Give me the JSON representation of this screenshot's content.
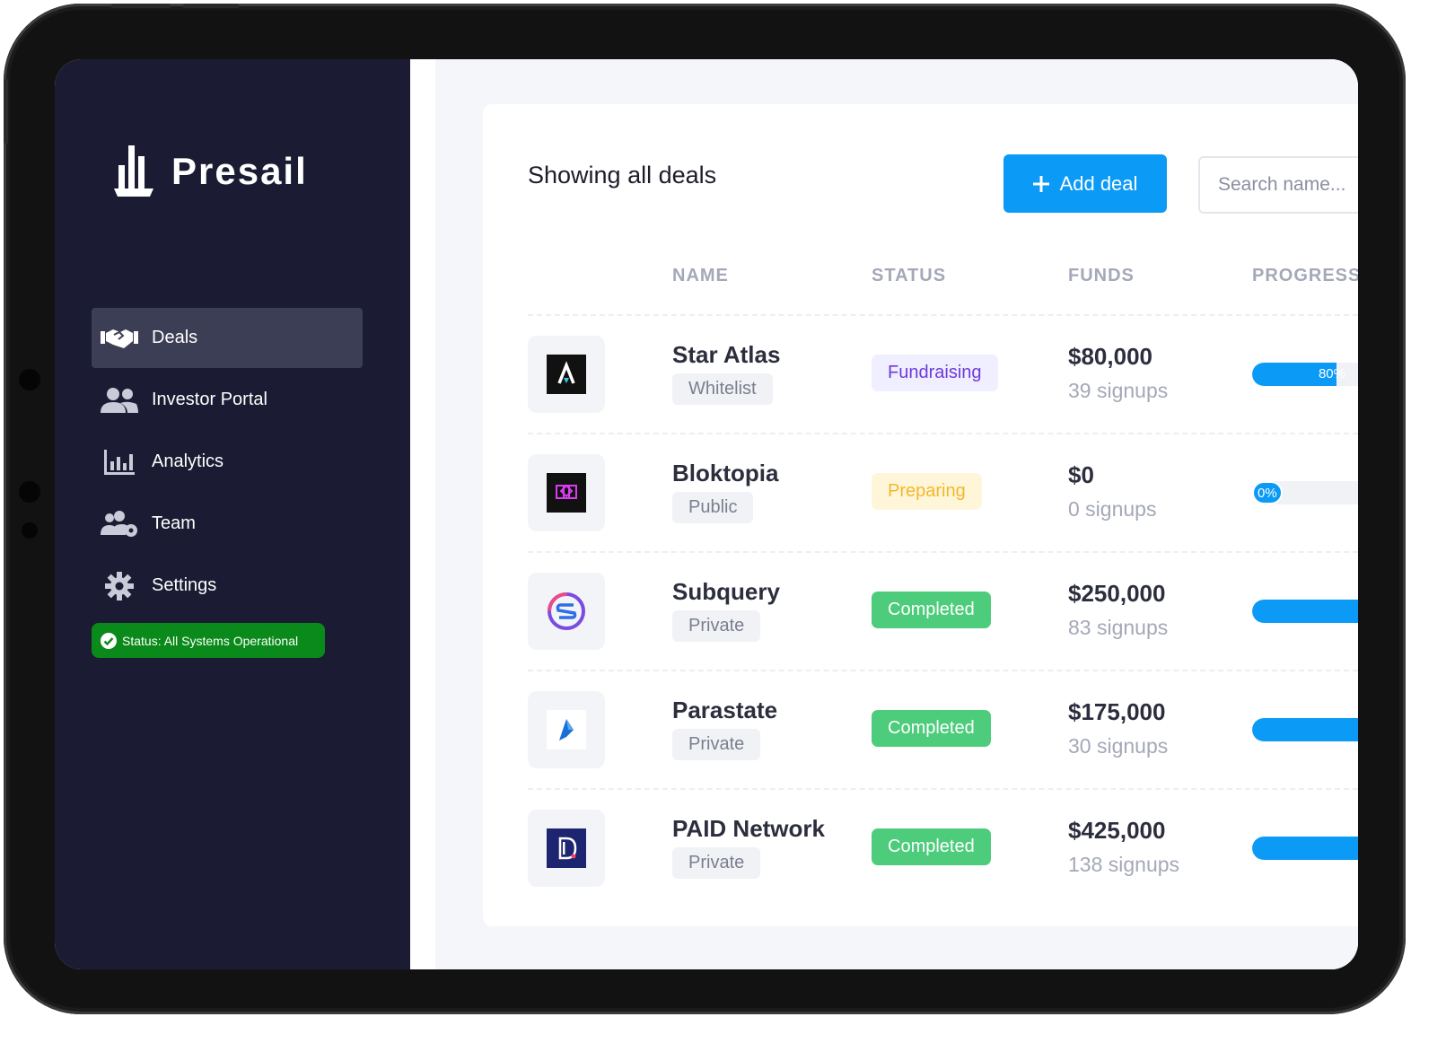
{
  "app": {
    "name": "Presail"
  },
  "sidebar": {
    "items": [
      {
        "label": "Deals",
        "icon": "handshake-icon",
        "active": true
      },
      {
        "label": "Investor Portal",
        "icon": "users-icon",
        "active": false
      },
      {
        "label": "Analytics",
        "icon": "bar-chart-icon",
        "active": false
      },
      {
        "label": "Team",
        "icon": "users-gear-icon",
        "active": false
      },
      {
        "label": "Settings",
        "icon": "gear-icon",
        "active": false
      }
    ],
    "status": {
      "label": "Status: All Systems Operational",
      "color": "#0a8a1a",
      "icon": "check-circle-icon"
    }
  },
  "main": {
    "title": "Showing all deals",
    "add_button": {
      "label": "Add deal",
      "icon": "plus-icon"
    },
    "search": {
      "placeholder": "Search name..."
    },
    "columns": [
      "NAME",
      "STATUS",
      "FUNDS",
      "PROGRESS"
    ],
    "deals": [
      {
        "name": "Star Atlas",
        "type": "Whitelist",
        "status": "Fundraising",
        "funds": "$80,000",
        "signups": "39 signups",
        "progress": 0.8,
        "progress_label": "80%",
        "logo": "star-atlas-logo"
      },
      {
        "name": "Bloktopia",
        "type": "Public",
        "status": "Preparing",
        "funds": "$0",
        "signups": "0 signups",
        "progress": 0.0,
        "progress_label": "0%",
        "logo": "bloktopia-logo"
      },
      {
        "name": "Subquery",
        "type": "Private",
        "status": "Completed",
        "funds": "$250,000",
        "signups": "83 signups",
        "progress": 1.0,
        "progress_label": "",
        "logo": "subquery-logo"
      },
      {
        "name": "Parastate",
        "type": "Private",
        "status": "Completed",
        "funds": "$175,000",
        "signups": "30 signups",
        "progress": 1.0,
        "progress_label": "",
        "logo": "parastate-logo"
      },
      {
        "name": "PAID Network",
        "type": "Private",
        "status": "Completed",
        "funds": "$425,000",
        "signups": "138 signups",
        "progress": 1.0,
        "progress_label": "",
        "logo": "paid-network-logo"
      }
    ]
  },
  "colors": {
    "sidebar_bg": "#1b1c33",
    "accent": "#0b9af5",
    "completed": "#4dcc7c",
    "fundraising": "#6e3bdc",
    "preparing": "#f3b72a"
  }
}
